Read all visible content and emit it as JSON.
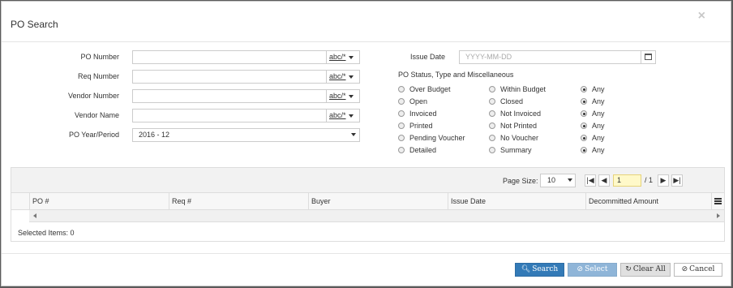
{
  "dialog": {
    "title": "PO Search",
    "close_glyph": "×"
  },
  "form": {
    "po_number": {
      "label": "PO Number",
      "value": "",
      "mode": "abc/*"
    },
    "req_number": {
      "label": "Req Number",
      "value": "",
      "mode": "abc/*"
    },
    "vendor_number": {
      "label": "Vendor Number",
      "value": "",
      "mode": "abc/*"
    },
    "vendor_name": {
      "label": "Vendor Name",
      "value": "",
      "mode": "abc/*"
    },
    "po_year_period": {
      "label": "PO Year/Period",
      "value": "2016 - 12"
    },
    "issue_date": {
      "label": "Issue Date",
      "placeholder": "YYYY-MM-DD"
    }
  },
  "status": {
    "heading": "PO Status, Type and Miscellaneous",
    "rows": [
      {
        "a": "Over Budget",
        "b": "Within Budget",
        "c": "Any",
        "selected": "c"
      },
      {
        "a": "Open",
        "b": "Closed",
        "c": "Any",
        "selected": "c"
      },
      {
        "a": "Invoiced",
        "b": "Not Invoiced",
        "c": "Any",
        "selected": "c"
      },
      {
        "a": "Printed",
        "b": "Not Printed",
        "c": "Any",
        "selected": "c"
      },
      {
        "a": "Pending Voucher",
        "b": "No Voucher",
        "c": "Any",
        "selected": "c"
      },
      {
        "a": "Detailed",
        "b": "Summary",
        "c": "Any",
        "selected": "c"
      }
    ]
  },
  "grid": {
    "page_size_label": "Page Size:",
    "page_size": "10",
    "page": "1",
    "total_pages": "/ 1",
    "columns": [
      "PO #",
      "Req #",
      "Buyer",
      "Issue Date",
      "Decommitted Amount"
    ],
    "selected_items": "Selected Items: 0"
  },
  "buttons": {
    "search": "Search",
    "select": "Select",
    "clear_all": "Clear All",
    "cancel": "Cancel"
  },
  "colors": {
    "primary": "#337ab7",
    "primary_disabled": "#8fb5d8"
  }
}
